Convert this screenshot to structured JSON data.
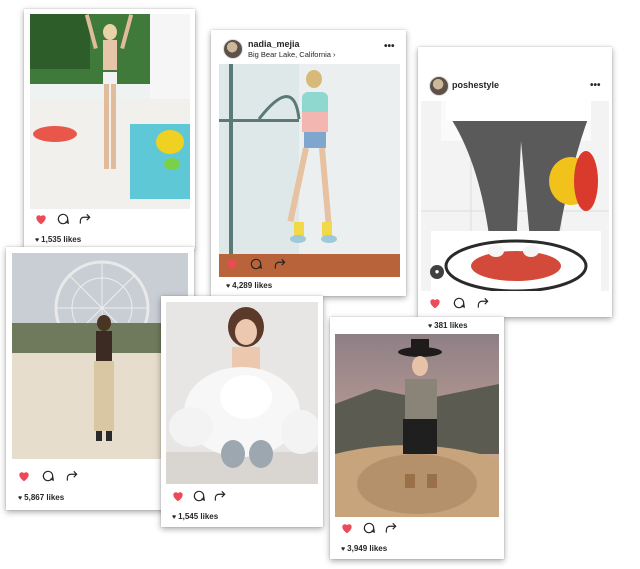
{
  "posts": [
    {
      "likes": "1,535 likes"
    },
    {
      "username": "nadia_mejia",
      "location": "Big Bear Lake, California ›",
      "more": "•••",
      "likes": "4,289 likes"
    },
    {
      "username": "poshestyle",
      "more": "•••",
      "likes": "381 likes"
    },
    {
      "likes": "5,867 likes"
    },
    {
      "likes": "1,545 likes"
    },
    {
      "likes": "3,949 likes"
    }
  ],
  "icons": {
    "like": "heart-icon",
    "comment": "comment-icon",
    "share": "share-icon",
    "more": "more-options-icon",
    "user_tag": "user-tag-icon"
  },
  "colors": {
    "like_active": "#ed4956",
    "text": "#262626",
    "icon_stroke": "#262626"
  }
}
